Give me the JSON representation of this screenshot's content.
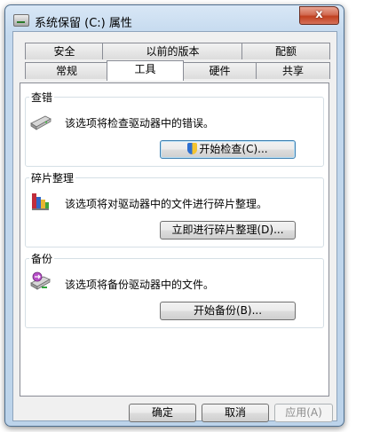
{
  "window": {
    "title": "系统保留 (C:) 属性",
    "close_label": "x"
  },
  "tabs_back": [
    "安全",
    "以前的版本",
    "配额"
  ],
  "tabs_front": [
    "常规",
    "工具",
    "硬件",
    "共享"
  ],
  "active_tab": "工具",
  "groups": [
    {
      "title": "查错",
      "description": "该选项将检查驱动器中的错误。",
      "button": "开始检查(C)...",
      "icon": "hard-drive-icon"
    },
    {
      "title": "碎片整理",
      "description": "该选项将对驱动器中的文件进行碎片整理。",
      "button": "立即进行碎片整理(D)...",
      "icon": "defrag-icon"
    },
    {
      "title": "备份",
      "description": "该选项将备份驱动器中的文件。",
      "button": "开始备份(B)...",
      "icon": "backup-icon"
    }
  ],
  "footer": {
    "ok": "确定",
    "cancel": "取消",
    "apply": "应用(A)"
  },
  "colors": {
    "close": "#c1401f",
    "frame": "#c4d9ee",
    "default_button_border": "#3c7fb1"
  }
}
